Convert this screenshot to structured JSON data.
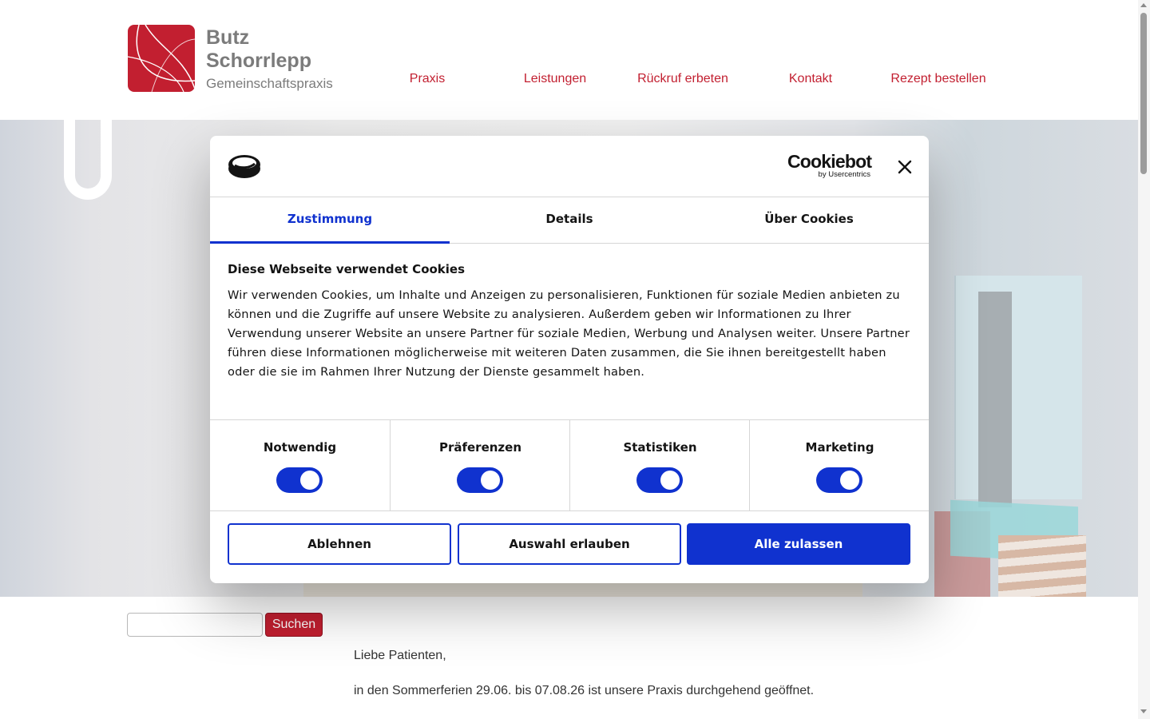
{
  "site": {
    "logo": {
      "line1": "Butz",
      "line2": "Schorrlepp",
      "subtitle": "Gemeinschaftspraxis",
      "color": "#c21f30",
      "icon": "practice-logo-icon"
    },
    "nav": [
      {
        "label": "Praxis"
      },
      {
        "label": "Leistungen"
      },
      {
        "label": "Rückruf erbeten"
      },
      {
        "label": "Kontakt"
      },
      {
        "label": "Rezept bestellen"
      }
    ],
    "accent_color": "#c21f30"
  },
  "cookie_dialog": {
    "brand": {
      "name": "Cookiebot",
      "byline": "by Usercentrics",
      "badge_icon": "cookiebot-badge-icon"
    },
    "close_icon": "close-icon",
    "tabs": [
      {
        "label": "Zustimmung",
        "active": true
      },
      {
        "label": "Details",
        "active": false
      },
      {
        "label": "Über Cookies",
        "active": false
      }
    ],
    "title": "Diese Webseite verwendet Cookies",
    "text": "Wir verwenden Cookies, um Inhalte und Anzeigen zu personalisieren, Funktionen für soziale Medien anbieten zu können und die Zugriffe auf unsere Website zu analysieren. Außerdem geben wir Informationen zu Ihrer Verwendung unserer Website an unsere Partner für soziale Medien, Werbung und Analysen weiter. Unsere Partner führen diese Informationen möglicherweise mit weiteren Daten zusammen, die Sie ihnen bereitgestellt haben oder die sie im Rahmen Ihrer Nutzung der Dienste gesammelt haben.",
    "categories": [
      {
        "label": "Notwendig",
        "enabled": true
      },
      {
        "label": "Präferenzen",
        "enabled": true
      },
      {
        "label": "Statistiken",
        "enabled": true
      },
      {
        "label": "Marketing",
        "enabled": true
      }
    ],
    "buttons": {
      "decline": "Ablehnen",
      "allow_selection": "Auswahl erlauben",
      "allow_all": "Alle zulassen"
    },
    "accent_color": "#1032cf"
  },
  "search": {
    "placeholder": "",
    "button_label": "Suchen"
  },
  "content": {
    "greeting": "Liebe Patienten,",
    "notice": "in den Sommerferien 29.06. bis 07.08.26 ist unsere Praxis durchgehend geöffnet."
  }
}
